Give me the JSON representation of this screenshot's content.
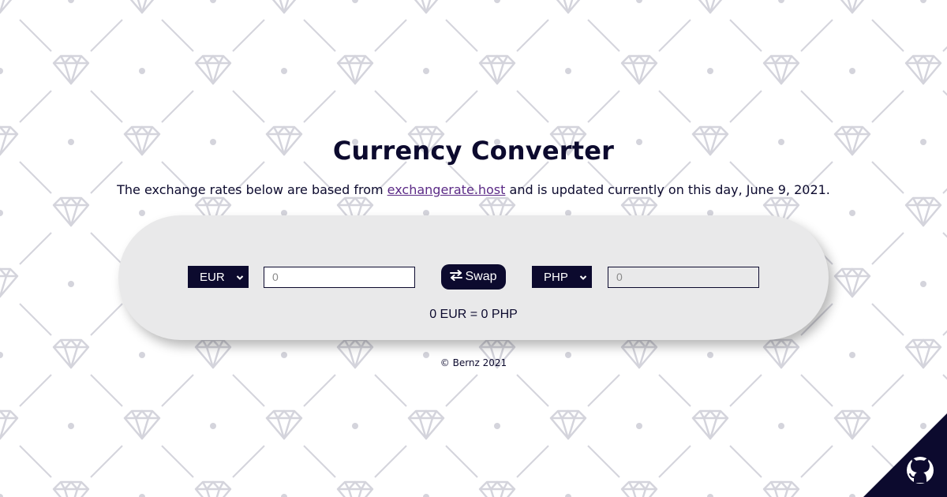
{
  "page": {
    "title": "Currency Converter",
    "subtitle_before": "The exchange rates below are based from ",
    "subtitle_link": "exchangerate.host",
    "subtitle_after": " and is updated currently on this day, June 9, 2021."
  },
  "converter": {
    "from_currency": "EUR",
    "from_amount_placeholder": "0",
    "swap_label": "Swap",
    "to_currency": "PHP",
    "to_amount_placeholder": "0",
    "result_text": "0 EUR = 0 PHP"
  },
  "footer": {
    "text": "© Bernz 2021"
  },
  "icons": {
    "swap": "swap-arrows-icon",
    "chevron": "chevron-down-icon",
    "github": "github-icon",
    "background": "diamond-icon"
  },
  "colors": {
    "primary": "#0c0a2e",
    "card_bg": "#e9e9ea",
    "link": "#5b2a86",
    "pattern": "#d4d4dc",
    "page_bg": "#ffffff"
  }
}
